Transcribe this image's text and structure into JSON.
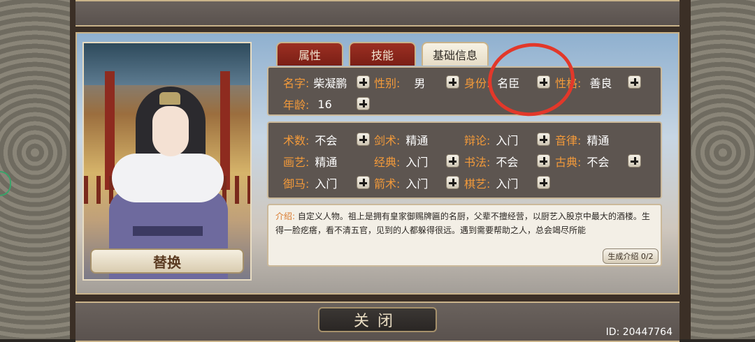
{
  "tabs": [
    {
      "label": "属性",
      "active": false
    },
    {
      "label": "技能",
      "active": false
    },
    {
      "label": "基础信息",
      "active": true
    }
  ],
  "basic": {
    "name_label": "名字:",
    "name_value": "柴凝鹏",
    "gender_label": "性别:",
    "gender_value": "男",
    "identity_label": "身份:",
    "identity_value": "名臣",
    "personality_label": "性格:",
    "personality_value": "善良",
    "age_label": "年龄:",
    "age_value": "16"
  },
  "skills": [
    {
      "label": "术数:",
      "value": "不会"
    },
    {
      "label": "剑术:",
      "value": "精通"
    },
    {
      "label": "辩论:",
      "value": "入门"
    },
    {
      "label": "音律:",
      "value": "精通"
    },
    {
      "label": "画艺:",
      "value": "精通"
    },
    {
      "label": "经典:",
      "value": "入门"
    },
    {
      "label": "书法:",
      "value": "不会"
    },
    {
      "label": "古典:",
      "value": "不会"
    },
    {
      "label": "御马:",
      "value": "入门"
    },
    {
      "label": "箭术:",
      "value": "入门"
    },
    {
      "label": "棋艺:",
      "value": "入门"
    }
  ],
  "description": {
    "label": "介绍:",
    "text": "自定义人物。祖上是拥有皇家御赐牌匾的名厨，父辈不擅经营，以厨艺入股京中最大的酒楼。生得一脸疙瘩，看不清五官，见到的人都躲得很远。遇到需要帮助之人，总会竭尽所能",
    "generate_label": "生成介绍 0/2"
  },
  "swap_label": "替换",
  "close_label": "关闭",
  "id_text": "ID: 20447764",
  "colors": {
    "label": "#f39a3a",
    "tab_red": "#9c2f22",
    "annotation": "#e2382a"
  }
}
